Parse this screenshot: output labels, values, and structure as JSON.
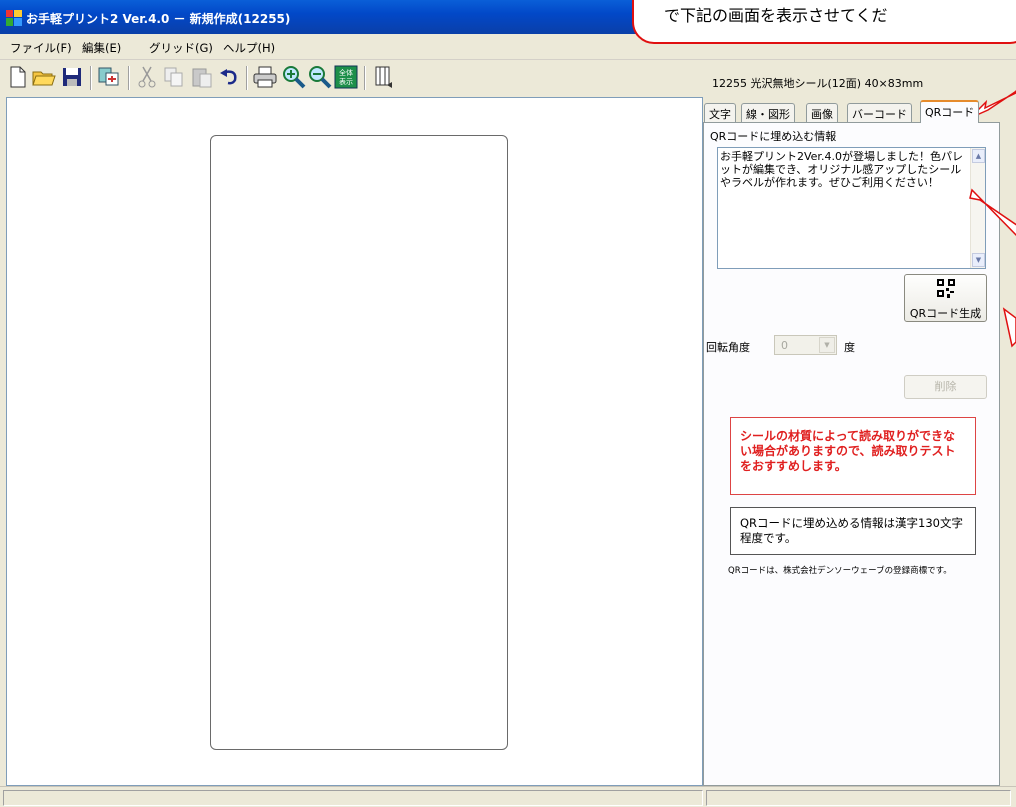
{
  "window": {
    "title": "お手軽プリント2 Ver.4.0 － 新規作成(12255)"
  },
  "menu": {
    "items": [
      "ファイル(F)",
      "編集(E)",
      "グリッド(G)",
      "ヘルプ(H)"
    ]
  },
  "toolbar": {
    "buttons": [
      "new-icon",
      "open-icon",
      "save-icon",
      "import-icon",
      "cut-icon",
      "copy-icon",
      "paste-icon",
      "undo-icon",
      "print-icon",
      "zoom-in-icon",
      "zoom-out-icon",
      "fit-all-icon",
      "rotate-paper-icon"
    ],
    "fit_all_text": "全体\n表示"
  },
  "panel": {
    "label_info": "12255 光沢無地シール(12面) 40×83mm",
    "tabs": [
      {
        "label": "文字",
        "active": false
      },
      {
        "label": "線・図形",
        "active": false
      },
      {
        "label": "画像",
        "active": false
      },
      {
        "label": "バーコード",
        "active": false
      },
      {
        "label": "QRコード",
        "active": true
      }
    ],
    "qr_info_label": "QRコードに埋め込む情報",
    "qr_text": "お手軽プリント2Ver.4.0が登場しました！色パレットが編集でき、オリジナル感アップしたシールやラベルが作れます。ぜひご利用ください！",
    "qr_button_label": "QRコード生成",
    "rotation_label": "回転角度",
    "rotation_value": "0",
    "rotation_unit": "度",
    "delete_label": "削除",
    "warning": "シールの材質によって読み取りができない場合がありますので、読み取りテストをおすすめします。",
    "info": "QRコードに埋め込める情報は漢字130文字程度です。",
    "trademark": "QRコードは、株式会社デンソーウェーブの登録商標です。"
  },
  "callout": {
    "text": "で下記の画面を表示させてくだ"
  },
  "colors": {
    "accent": "#0a3fa8",
    "warning": "#e02020",
    "annotation": "#e01010"
  }
}
